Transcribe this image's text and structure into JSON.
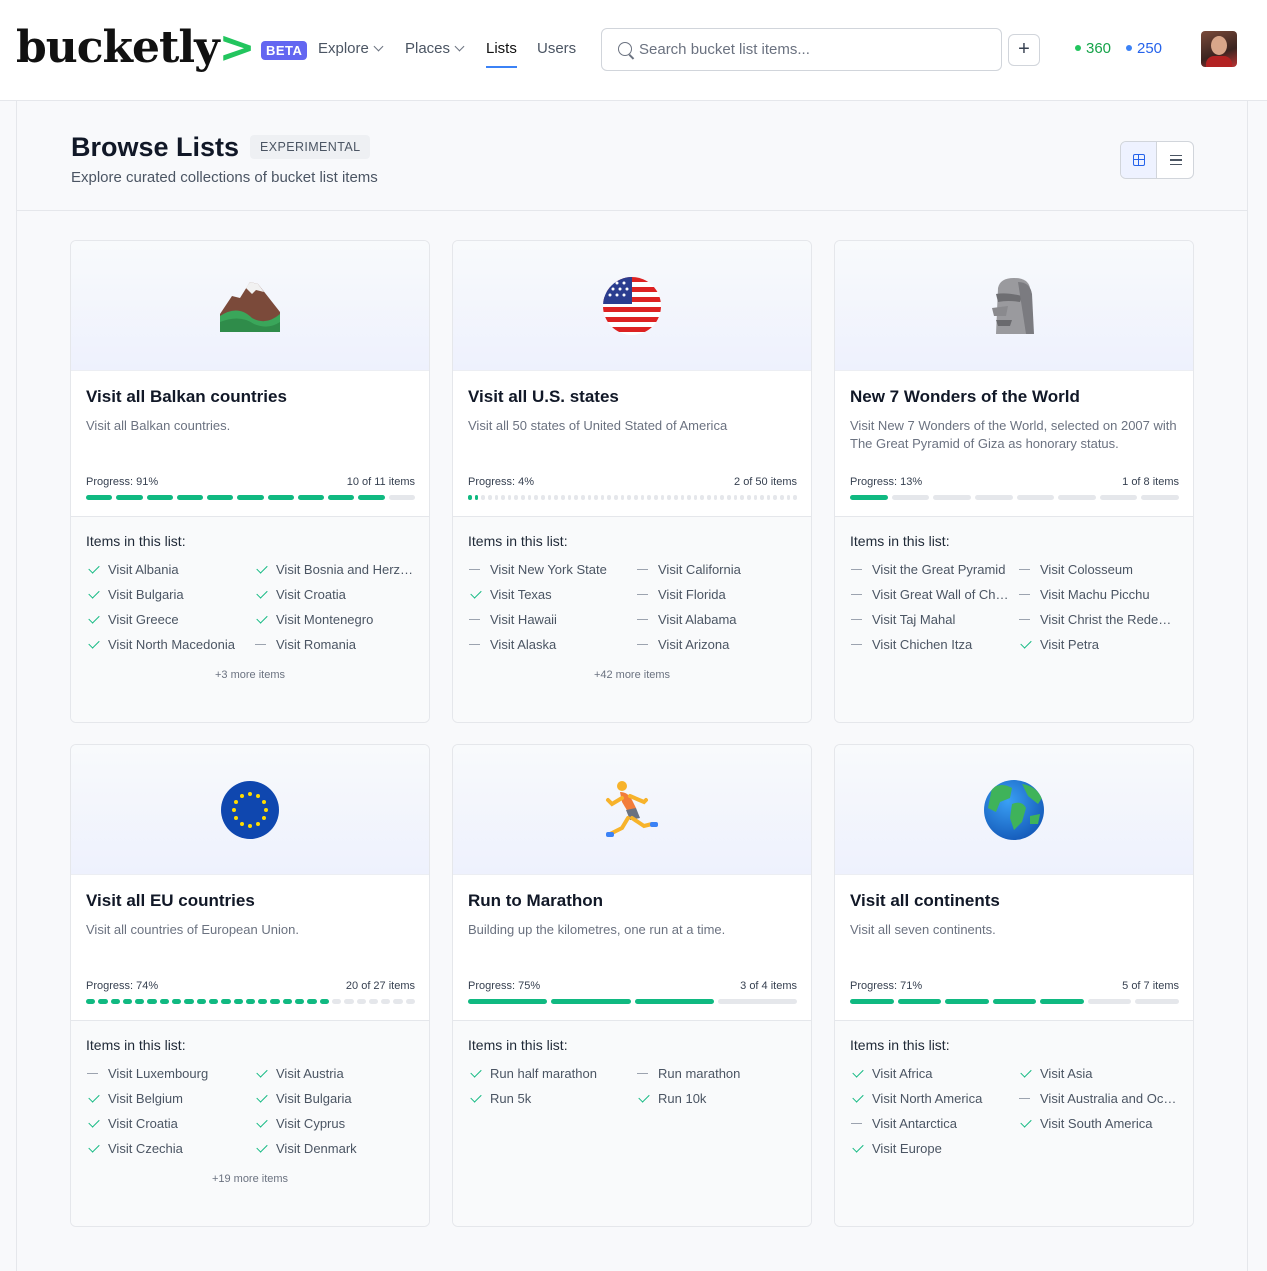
{
  "brand": {
    "logo": "bucketly",
    "logo_chevron": ">",
    "beta": "BETA"
  },
  "nav": {
    "explore": "Explore",
    "places": "Places",
    "lists": "Lists",
    "users": "Users"
  },
  "search": {
    "placeholder": "Search bucket list items..."
  },
  "add_label": "+",
  "stats": {
    "green": "360",
    "blue": "250",
    "green_color": "#22c55e",
    "blue_color": "#3b82f6"
  },
  "page": {
    "title": "Browse Lists",
    "badge": "EXPERIMENTAL",
    "subtitle": "Explore curated collections of bucket list items"
  },
  "cards": [
    {
      "icon": "mountain-icon",
      "title": "Visit all Balkan countries",
      "desc": "Visit all Balkan countries.",
      "progress_label": "Progress: 91%",
      "count": "10 of 11 items",
      "done": 10,
      "total": 11,
      "items_head": "Items in this list:",
      "items": [
        {
          "t": "Visit Albania",
          "d": true
        },
        {
          "t": "Visit Bosnia and Herzegovina",
          "d": true
        },
        {
          "t": "Visit Bulgaria",
          "d": true
        },
        {
          "t": "Visit Croatia",
          "d": true
        },
        {
          "t": "Visit Greece",
          "d": true
        },
        {
          "t": "Visit Montenegro",
          "d": true
        },
        {
          "t": "Visit North Macedonia",
          "d": true
        },
        {
          "t": "Visit Romania",
          "d": false
        }
      ],
      "more": "+3 more items"
    },
    {
      "icon": "us-flag-icon",
      "title": "Visit all U.S. states",
      "desc": "Visit all 50 states of United Stated of America",
      "progress_label": "Progress: 4%",
      "count": "2 of 50 items",
      "done": 2,
      "total": 50,
      "items_head": "Items in this list:",
      "items": [
        {
          "t": "Visit New York State",
          "d": false
        },
        {
          "t": "Visit California",
          "d": false
        },
        {
          "t": "Visit Texas",
          "d": true
        },
        {
          "t": "Visit Florida",
          "d": false
        },
        {
          "t": "Visit Hawaii",
          "d": false
        },
        {
          "t": "Visit Alabama",
          "d": false
        },
        {
          "t": "Visit Alaska",
          "d": false
        },
        {
          "t": "Visit Arizona",
          "d": false
        }
      ],
      "more": "+42 more items"
    },
    {
      "icon": "moai-icon",
      "title": "New 7 Wonders of the World",
      "desc": "Visit New 7 Wonders of the World, selected on 2007 with The Great Pyramid of Giza as honorary status.",
      "progress_label": "Progress: 13%",
      "count": "1 of 8 items",
      "done": 1,
      "total": 8,
      "items_head": "Items in this list:",
      "items": [
        {
          "t": "Visit the Great Pyramid",
          "d": false
        },
        {
          "t": "Visit Colosseum",
          "d": false
        },
        {
          "t": "Visit Great Wall of China",
          "d": false
        },
        {
          "t": "Visit Machu Picchu",
          "d": false
        },
        {
          "t": "Visit Taj Mahal",
          "d": false
        },
        {
          "t": "Visit Christ the Redeemer",
          "d": false
        },
        {
          "t": "Visit Chichen Itza",
          "d": false
        },
        {
          "t": "Visit Petra",
          "d": true
        }
      ],
      "more": ""
    },
    {
      "icon": "eu-flag-icon",
      "title": "Visit all EU countries",
      "desc": "Visit all countries of European Union.",
      "progress_label": "Progress: 74%",
      "count": "20 of 27 items",
      "done": 20,
      "total": 27,
      "items_head": "Items in this list:",
      "items": [
        {
          "t": "Visit Luxembourg",
          "d": false
        },
        {
          "t": "Visit Austria",
          "d": true
        },
        {
          "t": "Visit Belgium",
          "d": true
        },
        {
          "t": "Visit Bulgaria",
          "d": true
        },
        {
          "t": "Visit Croatia",
          "d": true
        },
        {
          "t": "Visit Cyprus",
          "d": true
        },
        {
          "t": "Visit Czechia",
          "d": true
        },
        {
          "t": "Visit Denmark",
          "d": true
        }
      ],
      "more": "+19 more items"
    },
    {
      "icon": "runner-icon",
      "title": "Run to Marathon",
      "desc": "Building up the kilometres, one run at a time.",
      "progress_label": "Progress: 75%",
      "count": "3 of 4 items",
      "done": 3,
      "total": 4,
      "items_head": "Items in this list:",
      "items": [
        {
          "t": "Run half marathon",
          "d": true
        },
        {
          "t": "Run marathon",
          "d": false
        },
        {
          "t": "Run 5k",
          "d": true
        },
        {
          "t": "Run 10k",
          "d": true
        }
      ],
      "more": ""
    },
    {
      "icon": "globe-icon",
      "title": "Visit all continents",
      "desc": "Visit all seven continents.",
      "progress_label": "Progress: 71%",
      "count": "5 of 7 items",
      "done": 5,
      "total": 7,
      "items_head": "Items in this list:",
      "items": [
        {
          "t": "Visit Africa",
          "d": true
        },
        {
          "t": "Visit Asia",
          "d": true
        },
        {
          "t": "Visit North America",
          "d": true
        },
        {
          "t": "Visit Australia and Oceania",
          "d": false
        },
        {
          "t": "Visit Antarctica",
          "d": false
        },
        {
          "t": "Visit South America",
          "d": true
        },
        {
          "t": "Visit Europe",
          "d": true
        }
      ],
      "more": ""
    }
  ]
}
